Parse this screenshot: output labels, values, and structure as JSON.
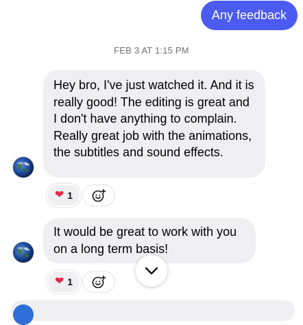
{
  "conversation": {
    "sent_message": "Any feedback",
    "timestamp": "FEB 3 AT 1:15 PM",
    "received_messages": [
      {
        "text": "Hey bro, I've just watched it. And it is really good! The editing is great and I don't have anything to complain. Really great job with the animations, the subtitles and sound effects.",
        "reaction": {
          "icon": "heart",
          "count": "1"
        }
      },
      {
        "text": "It would be great to work with you on a long term basis!",
        "reaction": {
          "icon": "heart",
          "count": "1"
        }
      }
    ]
  },
  "icons": {
    "reaction": "red-heart-icon",
    "add_reaction": "add-emoji-icon",
    "scroll": "chevron-down-icon",
    "avatar": "earth-globe-avatar"
  },
  "colors": {
    "sent_bubble": "#4c5bef",
    "received_bubble": "#efeff1",
    "heart": "#e8264a",
    "timestamp_text": "#6e6e73"
  }
}
